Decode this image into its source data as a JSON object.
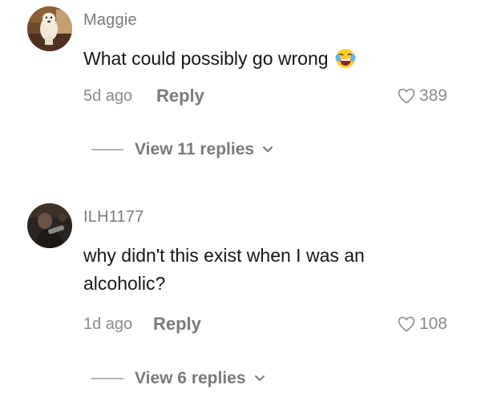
{
  "comments": [
    {
      "username": "Maggie",
      "text": "What could possibly go wrong",
      "emoji": "tears-of-joy-emoji",
      "time": "5d ago",
      "reply_label": "Reply",
      "likes": "389",
      "view_replies": "View 11 replies"
    },
    {
      "username": "ILH1177",
      "text": "why didn't this exist when I was an alcoholic?",
      "time": "1d ago",
      "reply_label": "Reply",
      "likes": "108",
      "view_replies": "View 6 replies"
    }
  ]
}
